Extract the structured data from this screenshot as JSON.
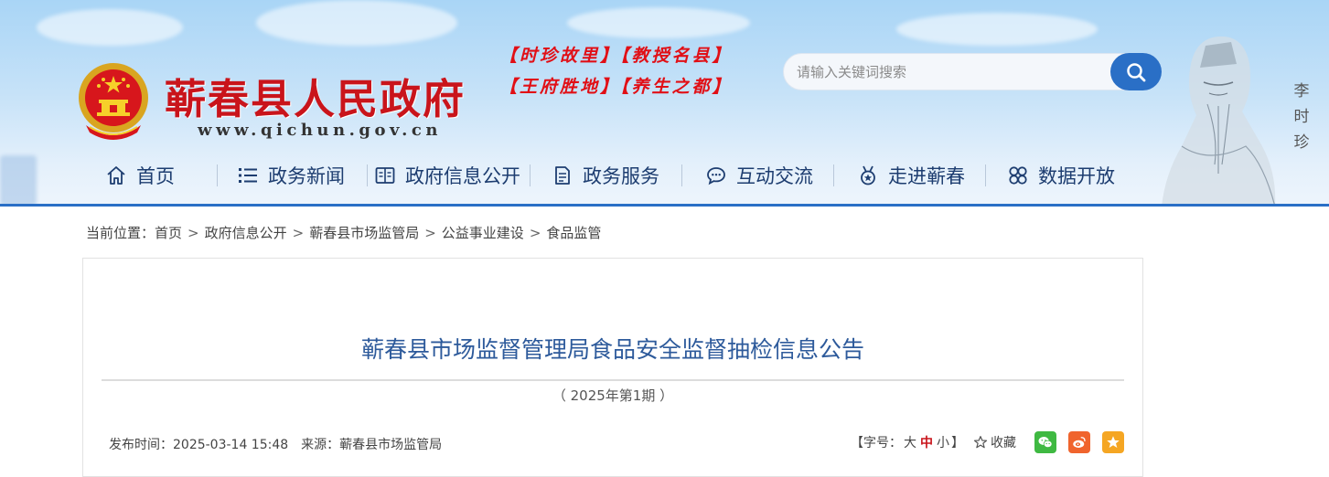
{
  "header": {
    "site_title": "蕲春县人民政府",
    "site_url": "www.qichun.gov.cn",
    "slogan_line1": "【时珍故里】【教授名县】",
    "slogan_line2": "【王府胜地】【养生之都】",
    "search": {
      "placeholder": "请输入关键词搜索"
    },
    "portrait_name": [
      "李",
      "时",
      "珍"
    ]
  },
  "nav": {
    "items": [
      {
        "label": "首页",
        "icon": "home-icon"
      },
      {
        "label": "政务新闻",
        "icon": "list-icon"
      },
      {
        "label": "政府信息公开",
        "icon": "book-icon"
      },
      {
        "label": "政务服务",
        "icon": "document-icon"
      },
      {
        "label": "互动交流",
        "icon": "chat-icon"
      },
      {
        "label": "走进蕲春",
        "icon": "medal-icon"
      },
      {
        "label": "数据开放",
        "icon": "data-icon"
      }
    ]
  },
  "breadcrumb": {
    "prefix": "当前位置：",
    "items": [
      "首页",
      "政府信息公开",
      "蕲春县市场监管局",
      "公益事业建设",
      "食品监管"
    ],
    "separator": ">"
  },
  "article": {
    "title": "蕲春县市场监督管理局食品安全监督抽检信息公告",
    "subtitle": "（ 2025年第1期 ）",
    "publish_time": "发布时间：2025-03-14 15:48",
    "source": "来源：蕲春县市场监管局",
    "font_size_prefix": "【字号：",
    "font_large": "大",
    "font_medium": "中",
    "font_small": "小",
    "font_size_suffix": "】",
    "favorite": "收藏"
  },
  "colors": {
    "brand_blue": "#2a6fc6",
    "title_red": "#c9141b",
    "article_title": "#2d5a9b",
    "wechat": "#3fb942",
    "weibo": "#f0642d",
    "qzone": "#f5a623"
  }
}
